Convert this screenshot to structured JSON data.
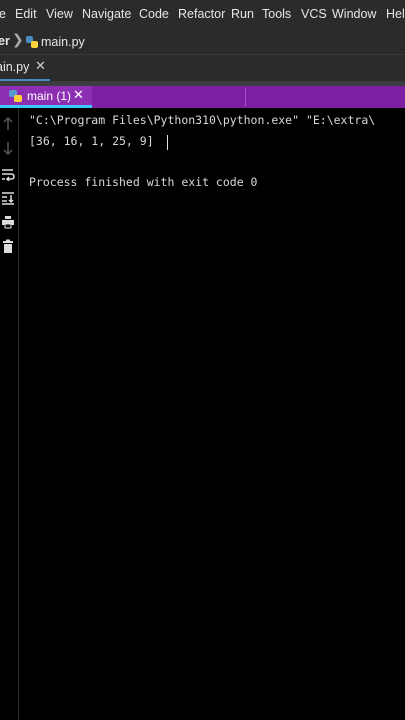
{
  "menubar": {
    "items": [
      "e",
      "Edit",
      "View",
      "Navigate",
      "Code",
      "Refactor",
      "Run",
      "Tools",
      "VCS",
      "Window",
      "Help"
    ]
  },
  "breadcrumb": {
    "project": "er",
    "file": "main.py"
  },
  "editor_tab": {
    "label": "ain.py",
    "close": "✕"
  },
  "run_tab": {
    "label": "main (1)",
    "close": "✕"
  },
  "console": {
    "command": "\"C:\\Program Files\\Python310\\python.exe\" \"E:\\extra\\",
    "output": "[36, 16, 1, 25, 9]",
    "finish": "Process finished with exit code 0"
  },
  "icons": [
    "up-arrow-icon",
    "down-arrow-icon",
    "soft-wrap-icon",
    "scroll-to-end-icon",
    "print-icon",
    "trash-icon"
  ]
}
